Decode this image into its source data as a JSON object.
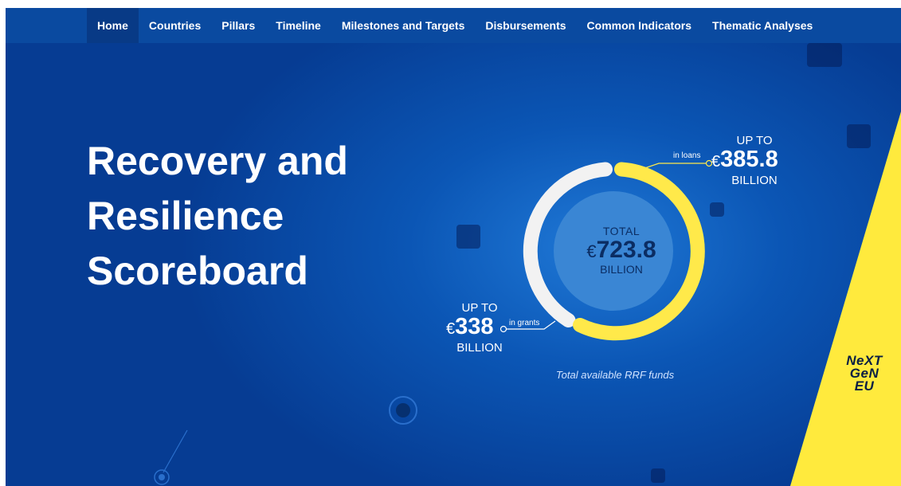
{
  "nav": {
    "items": [
      {
        "label": "Home",
        "active": true
      },
      {
        "label": "Countries"
      },
      {
        "label": "Pillars"
      },
      {
        "label": "Timeline"
      },
      {
        "label": "Milestones and Targets"
      },
      {
        "label": "Disbursements"
      },
      {
        "label": "Common Indicators"
      },
      {
        "label": "Thematic Analyses"
      }
    ]
  },
  "hero": {
    "title_line1": "Recovery and",
    "title_line2": "Resilience",
    "title_line3": "Scoreboard"
  },
  "funds": {
    "total_label": "TOTAL",
    "total_currency": "€",
    "total_value": "723.8",
    "total_unit": "BILLION",
    "loans_upto": "UP TO",
    "loans_currency": "€",
    "loans_value": "385.8",
    "loans_unit": "BILLION",
    "loans_label": "in loans",
    "grants_upto": "UP TO",
    "grants_currency": "€",
    "grants_value": "338",
    "grants_unit": "BILLION",
    "grants_label": "in grants",
    "caption": "Total available RRF funds"
  },
  "badge": {
    "line1": "NeXT",
    "line2": "GeN",
    "line3": "EU"
  },
  "colors": {
    "nav_bg": "#0a4aa0",
    "nav_active": "#083a86",
    "loans_arc": "#ffe94a",
    "grants_arc": "#f2f2f2",
    "inner_circle": "#3a86d4",
    "badge_yellow": "#ffea3d"
  }
}
